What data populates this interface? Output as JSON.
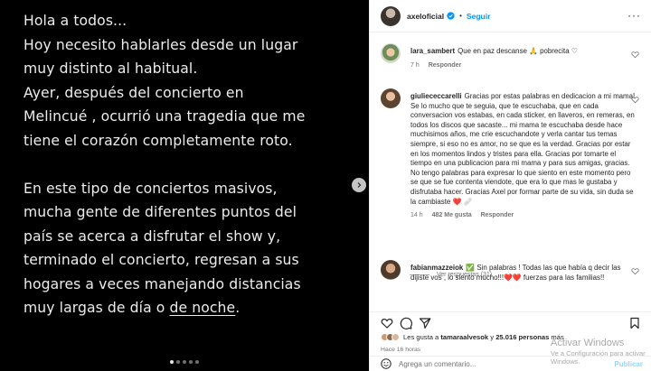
{
  "post": {
    "lines_1": [
      "Hola a todos...",
      "Hoy necesito hablarles desde un lugar",
      "muy distinto al habitual.",
      "Ayer, después del concierto en",
      "Melincué , ocurrió una tragedia que me",
      "tiene el corazón completamente roto."
    ],
    "lines_2": [
      "En este tipo de conciertos masivos,",
      "mucha gente de diferentes puntos del",
      "país se acerca a disfrutar el show y,",
      "terminado el concierto, regresan a sus",
      "hogares a veces manejando distancias"
    ],
    "last_line_prefix": "muy largas de día o ",
    "last_line_underlined": "de noche",
    "last_line_suffix": ".",
    "carousel": {
      "total": 5,
      "active": 0
    }
  },
  "header": {
    "username": "axeloficial",
    "separator": "•",
    "follow_label": "Seguir",
    "more_icon": "more-horizontal-icon"
  },
  "comments": [
    {
      "username": "lara_sambert",
      "text": "Que en paz descanse 🙏 pobrecita ♡",
      "time": "7 h",
      "reply_label": "Responder"
    },
    {
      "username": "giuliececcarelli",
      "text": "Gracias por estas palabras en dedicacion a mi mama! Se lo mucho que te seguia, que te escuchaba, que en cada conversacion vos estabas, en cada sticker, en llaveros, en remeras, en todos los discos que sacaste... mi mama te escuchaba desde hace muchisimos años, me crie escuchandote y verla cantar tus temas siempre, si eso no es amor, no se que es la verdad. Gracias por estar en los momentos lindos y tristes para ella. Gracias por tomarte el tiempo en una publicacion para mi mama y para sus amigas, gracias. No tengo palabras para expresar lo que siento en este momento pero se que se fue contenta viendote, que era lo que mas le gustaba y disfrutaba hacer. Gracias Axel por formar parte de su vida, sin duda se la cambiaste ❤️ 🩹",
      "time": "14 h",
      "likes": "482 Me gusta",
      "reply_label": "Responder",
      "view_replies": "Ver respuestas (31)"
    },
    {
      "username": "fabianmazzeiok",
      "text": "✅ Sin palabras ! Todas las que había q decir las dijiste vos , lo siento mucho!!!❤️❤️ fuerzas para las familias!!",
      "time": ""
    }
  ],
  "likes": {
    "prefix": "Les gusta a ",
    "user": "tamaraalvesok",
    "middle": " y ",
    "count": "25.016 personas",
    "suffix": " más"
  },
  "timestamp": "Hace 16 horas",
  "add_comment": {
    "placeholder": "Agrega un comentario...",
    "publish_label": "Publicar"
  },
  "watermark": {
    "title": "Activar Windows",
    "subtitle": "Ve a Configuración para activar Windows."
  }
}
